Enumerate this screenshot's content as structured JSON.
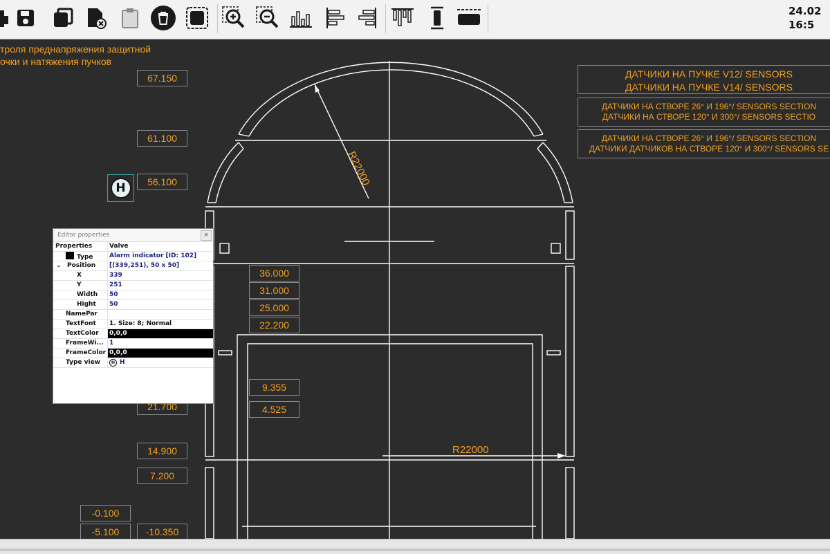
{
  "clock": {
    "date": "24.02",
    "time": "16:5"
  },
  "toolbar": {
    "buttons": [
      {
        "name": "print-icon"
      },
      {
        "name": "save-icon"
      },
      {
        "name": "copy-icon"
      },
      {
        "name": "delete-file-icon"
      },
      {
        "name": "clipboard-icon"
      },
      {
        "name": "trash-icon"
      },
      {
        "name": "select-frame-icon"
      },
      {
        "name": "zoom-in-icon"
      },
      {
        "name": "zoom-out-icon"
      },
      {
        "name": "align-bottom-icon"
      },
      {
        "name": "align-left-icon"
      },
      {
        "name": "align-right-icon"
      },
      {
        "name": "align-top-icon"
      },
      {
        "name": "distribute-vertical-icon"
      },
      {
        "name": "distribute-horizontal-icon"
      }
    ]
  },
  "caption": {
    "line1": "троля преднапряжения защитной",
    "line2": "очки и натяжения пучков"
  },
  "values": {
    "v67150": "67.150",
    "v61100": "61.100",
    "v56100": "56.100",
    "v36000": "36.000",
    "v31000": "31.000",
    "v25000": "25.000",
    "v22200": "22.200",
    "v9355": "9.355",
    "v4525": "4.525",
    "v21700": "21.700",
    "v14900": "14.900",
    "v7200": "7.200",
    "vm0100": "-0.100",
    "vm5100": "-5.100",
    "vm10350": "-10.350"
  },
  "drawing": {
    "radius_arc": "R22000",
    "radius_horizontal": "R22000"
  },
  "legend": {
    "v_line1": "ДАТЧИКИ НА ПУЧКЕ V12/ SENSORS",
    "v_line2": "ДАТЧИКИ НА ПУЧКЕ V14/ SENSORS",
    "s1_line1": "ДАТЧИКИ НА СТВОРЕ 26° И 196°/ SENSORS SECTION",
    "s1_line2": "ДАТЧИКИ НА СТВОРЕ 120° И 300°/ SENSORS SECTIO",
    "s2_line1": "ДАТЧИКИ НА СТВОРЕ 26° И 196°/ SENSORS SECTION",
    "s2_line2": "ДАТЧИКИ ДАТЧИКОВ НА СТВОРЕ 120° И 300°/ SENSORS SE"
  },
  "alarm": {
    "letter": "H"
  },
  "properties": {
    "title": "Editor properties",
    "close": "×",
    "rows": [
      {
        "name": "Properties",
        "value": "Valve"
      },
      {
        "name": "Type",
        "value": "Alarm indicator [ID: 102]"
      },
      {
        "name": "Position",
        "value": "[(339,251), 50 x 50]"
      },
      {
        "name": "X",
        "value": "339"
      },
      {
        "name": "Y",
        "value": "251"
      },
      {
        "name": "Width",
        "value": "50"
      },
      {
        "name": "Hight",
        "value": "50"
      },
      {
        "name": "NamePar",
        "value": ""
      },
      {
        "name": "TextFont",
        "value": "1. Size: 8; Normal"
      },
      {
        "name": "TextColor",
        "value": "0,0,0"
      },
      {
        "name": "FrameWi...",
        "value": "1"
      },
      {
        "name": "FrameColor",
        "value": "0,0,0"
      },
      {
        "name": "Type view",
        "value": "H"
      }
    ]
  }
}
